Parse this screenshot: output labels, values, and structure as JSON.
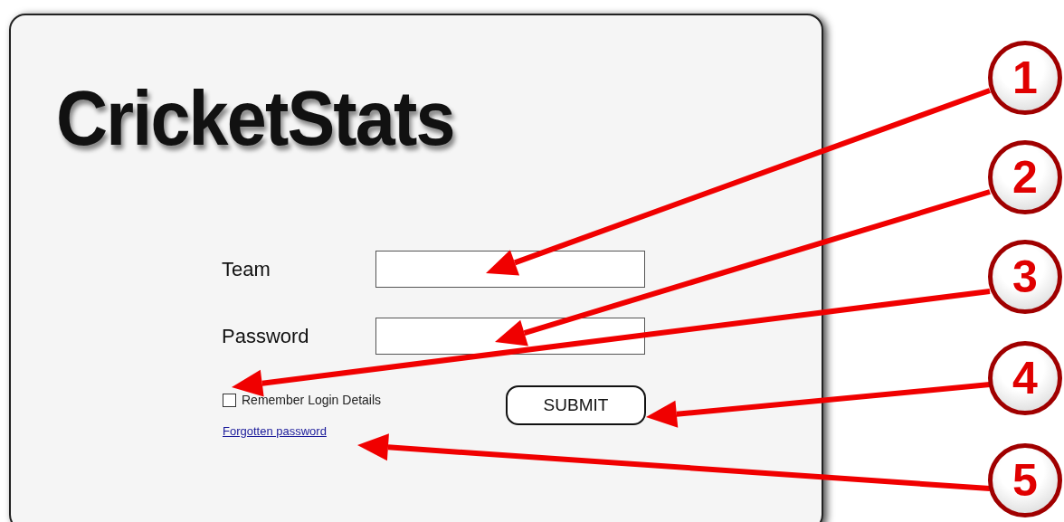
{
  "logo": "CricketStats",
  "fields": [
    {
      "label": "Team"
    },
    {
      "label": "Password"
    }
  ],
  "remember": {
    "label": "Remember Login Details",
    "checked": false
  },
  "submit": "SUBMIT",
  "forgot_link": "Forgotten password",
  "callouts": [
    "1",
    "2",
    "3",
    "4",
    "5"
  ]
}
